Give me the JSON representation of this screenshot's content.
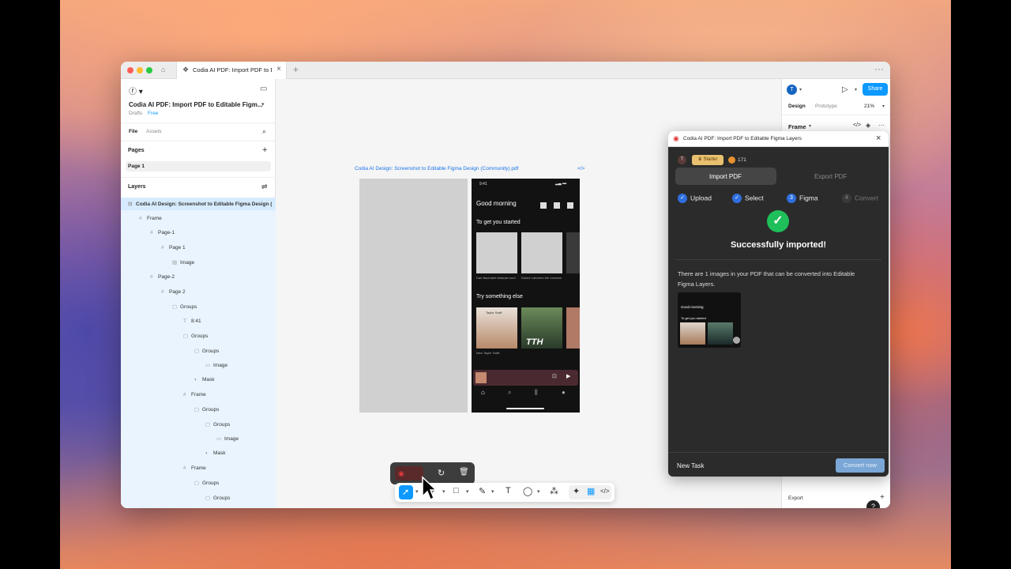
{
  "browser": {
    "tab_title": "Codia AI PDF: Import PDF to Editable",
    "tab_close": "×",
    "tab_add": "+",
    "more": "···"
  },
  "left_panel": {
    "file_name": "Codia AI PDF: Import PDF to Editable Figm...",
    "drafts": "Drafts",
    "plan_badge": "Free",
    "tabs": [
      "File",
      "Assets"
    ],
    "pages_heading": "Pages",
    "pages": [
      "Page 1"
    ],
    "layers_heading": "Layers",
    "layers": [
      "Codia AI Design: Screenshot to Editable Figma Design (",
      "Frame",
      "Page-1",
      "Page 1",
      "Image",
      "Page-2",
      "Page 2",
      "Groups",
      "8:41",
      "Groups",
      "Groups",
      "Image",
      "Mask",
      "Frame",
      "Groups",
      "Groups",
      "Image",
      "Mask",
      "Frame",
      "Groups",
      "Groups"
    ]
  },
  "canvas": {
    "frame_label": "Codia AI Design: Screenshot to Editable Figma Design (Community).pdf",
    "phone": {
      "time": "9:41",
      "greeting": "Good morning",
      "section1": "To get you started",
      "section2": "Try something else",
      "card_caption_left": "New Taylor Swift",
      "card_album": "Taylor Swift",
      "card_overlay": "TTH",
      "caption_a": "Dan Bachdalir tasisuse sunt",
      "caption_b": "Dolore Laborem the exercise"
    }
  },
  "right_panel": {
    "avatar": "T",
    "share": "Share",
    "tabs": [
      "Design",
      "Prototype"
    ],
    "zoom": "21%",
    "frame_label": "Frame",
    "export_label": "Export",
    "help": "?"
  },
  "plugin": {
    "title": "Codia AI PDF: Import PDF to Editable Figma Layers",
    "close": "×",
    "user_initial": "T",
    "plan": "Starter",
    "credits": "171",
    "tab_import": "Import PDF",
    "tab_export": "Export PDF",
    "steps": [
      {
        "label": "Upload",
        "mark": "✓"
      },
      {
        "label": "Select",
        "mark": "✓"
      },
      {
        "label": "Figma",
        "mark": "3"
      },
      {
        "label": "Convert",
        "mark": "4"
      }
    ],
    "success": "Successfully imported!",
    "message": "There are 1 images in your PDF that can be converted into Editable Figma Layers.",
    "thumb_greeting": "Good morning",
    "thumb_section": "To get you started",
    "new_task": "New Task",
    "convert_now": "Convert now"
  },
  "colors": {
    "accent": "#0d99ff",
    "success": "#1fbf5a",
    "plugin_bg": "#2b2b2b",
    "step_blue": "#2f6fe0"
  }
}
